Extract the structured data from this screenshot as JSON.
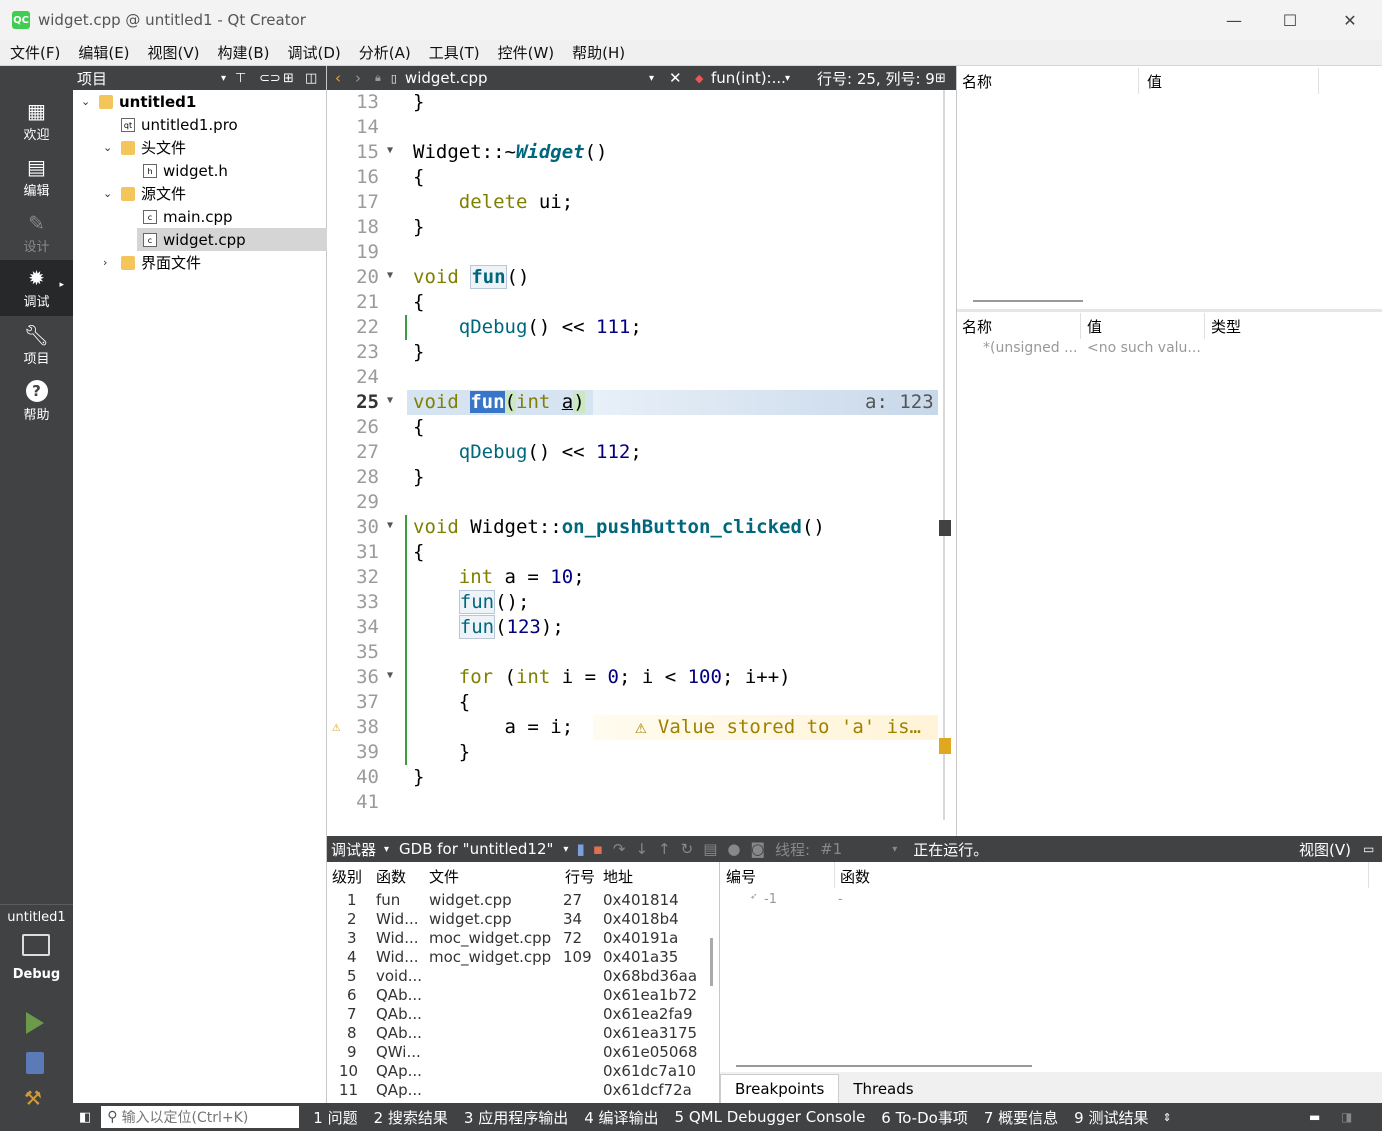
{
  "window": {
    "title": "widget.cpp @ untitled1 - Qt Creator",
    "logo": "QC"
  },
  "menu": [
    "文件(F)",
    "编辑(E)",
    "视图(V)",
    "构建(B)",
    "调试(D)",
    "分析(A)",
    "工具(T)",
    "控件(W)",
    "帮助(H)"
  ],
  "modes": [
    {
      "label": "欢迎",
      "icon": "grid-icon"
    },
    {
      "label": "编辑",
      "icon": "document-icon"
    },
    {
      "label": "设计",
      "icon": "pencil-icon"
    },
    {
      "label": "调试",
      "icon": "bug-icon"
    },
    {
      "label": "项目",
      "icon": "wrench-icon"
    },
    {
      "label": "帮助",
      "icon": "help-icon"
    }
  ],
  "kit": {
    "project": "untitled1",
    "config": "Debug"
  },
  "project_pane": {
    "title": "项目",
    "tree": [
      {
        "label": "untitled1",
        "level": 0,
        "type": "project",
        "bold": true
      },
      {
        "label": "untitled1.pro",
        "level": 1,
        "type": "file"
      },
      {
        "label": "头文件",
        "level": 1,
        "type": "folder"
      },
      {
        "label": "widget.h",
        "level": 2,
        "type": "file"
      },
      {
        "label": "源文件",
        "level": 1,
        "type": "folder"
      },
      {
        "label": "main.cpp",
        "level": 2,
        "type": "file"
      },
      {
        "label": "widget.cpp",
        "level": 2,
        "type": "file",
        "selected": true
      },
      {
        "label": "界面文件",
        "level": 1,
        "type": "folder"
      }
    ]
  },
  "editor": {
    "filename": "widget.cpp",
    "symbol": "fun(int):...",
    "position": "行号: 25, 列号: 9",
    "current_line": 25,
    "inline_value": "a: 123",
    "warning_text": "⚠ Value stored to 'a' is…",
    "lines": [
      {
        "n": "13",
        "code": "}"
      },
      {
        "n": "14",
        "code": ""
      },
      {
        "n": "15",
        "code": "Widget::~Widget()"
      },
      {
        "n": "16",
        "code": "{"
      },
      {
        "n": "17",
        "code": "    delete ui;"
      },
      {
        "n": "18",
        "code": "}"
      },
      {
        "n": "19",
        "code": ""
      },
      {
        "n": "20",
        "code": "void fun()"
      },
      {
        "n": "21",
        "code": "{"
      },
      {
        "n": "22",
        "code": "    qDebug() << 111;"
      },
      {
        "n": "23",
        "code": "}"
      },
      {
        "n": "24",
        "code": ""
      },
      {
        "n": "25",
        "code": "void fun(int a)"
      },
      {
        "n": "26",
        "code": "{"
      },
      {
        "n": "27",
        "code": "    qDebug() << 112;"
      },
      {
        "n": "28",
        "code": "}"
      },
      {
        "n": "29",
        "code": ""
      },
      {
        "n": "30",
        "code": "void Widget::on_pushButton_clicked()"
      },
      {
        "n": "31",
        "code": "{"
      },
      {
        "n": "32",
        "code": "    int a = 10;"
      },
      {
        "n": "33",
        "code": "    fun();"
      },
      {
        "n": "34",
        "code": "    fun(123);"
      },
      {
        "n": "35",
        "code": ""
      },
      {
        "n": "36",
        "code": "    for (int i = 0; i < 100; i++)"
      },
      {
        "n": "37",
        "code": "    {"
      },
      {
        "n": "38",
        "code": "        a = i;"
      },
      {
        "n": "39",
        "code": "    }"
      },
      {
        "n": "40",
        "code": "}"
      },
      {
        "n": "41",
        "code": ""
      }
    ]
  },
  "locals_pane": {
    "col_name": "名称",
    "col_value": "值"
  },
  "expressions_pane": {
    "col_name": "名称",
    "col_value": "值",
    "col_type": "类型",
    "row_name": "*(unsigned ...",
    "row_value": "<no such valu..."
  },
  "debugger_bar": {
    "label": "调试器",
    "engine": "GDB for \"untitled12\"",
    "thread_label": "线程:",
    "thread_value": "#1",
    "status": "正在运行。",
    "view": "视图(V)"
  },
  "stack": {
    "headers": [
      "级别",
      "函数",
      "文件",
      "行号",
      "地址"
    ],
    "rows": [
      [
        "1",
        "fun",
        "widget.cpp",
        "27",
        "0x401814"
      ],
      [
        "2",
        "Wid...",
        "widget.cpp",
        "34",
        "0x4018b4"
      ],
      [
        "3",
        "Wid...",
        "moc_widget.cpp",
        "72",
        "0x40191a"
      ],
      [
        "4",
        "Wid...",
        "moc_widget.cpp",
        "109",
        "0x401a35"
      ],
      [
        "5",
        "void...",
        "",
        "",
        "0x68bd36aa"
      ],
      [
        "6",
        "QAb...",
        "",
        "",
        "0x61ea1b72"
      ],
      [
        "7",
        "QAb...",
        "",
        "",
        "0x61ea2fa9"
      ],
      [
        "8",
        "QAb...",
        "",
        "",
        "0x61ea3175"
      ],
      [
        "9",
        "QWi...",
        "",
        "",
        "0x61e05068"
      ],
      [
        "10",
        "QAp...",
        "",
        "",
        "0x61dc7a10"
      ],
      [
        "11",
        "QAp...",
        "",
        "",
        "0x61dcf72a"
      ]
    ]
  },
  "breakpoints": {
    "headers": [
      "编号",
      "函数"
    ],
    "row_number": "-1",
    "row_function": "-",
    "tabs": [
      "Breakpoints",
      "Threads"
    ]
  },
  "statusbar": {
    "locator_placeholder": "输入以定位(Ctrl+K)",
    "outputs": [
      "1 问题",
      "2 搜索结果",
      "3 应用程序输出",
      "4 编译输出",
      "5 QML Debugger Console",
      "6 To-Do事项",
      "7 概要信息",
      "9 测试结果"
    ]
  }
}
